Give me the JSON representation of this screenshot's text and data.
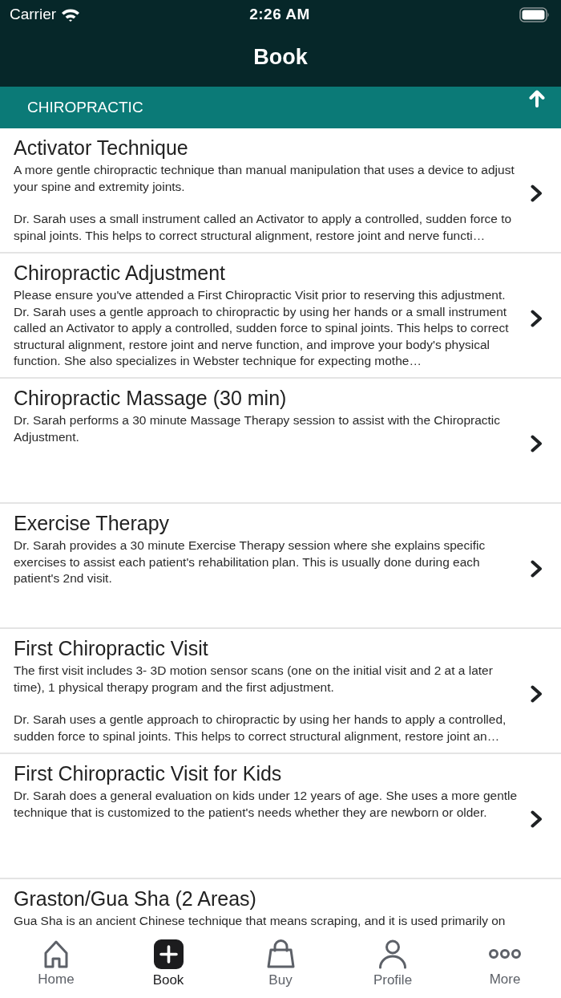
{
  "status_bar": {
    "carrier": "Carrier",
    "time": "2:26 AM"
  },
  "nav_bar": {
    "title": "Book"
  },
  "section": {
    "title": "CHIROPRACTIC"
  },
  "services": [
    {
      "title": "Activator Technique",
      "description": [
        "A more gentle chiropractic technique than manual manipulation that uses a device to adjust your spine and extremity joints.",
        "Dr. Sarah uses a small instrument called an Activator to apply a controlled, sudden force to spinal joints. This helps to correct structural alignment, restore joint and nerve functi…"
      ]
    },
    {
      "title": "Chiropractic Adjustment",
      "description": [
        "Please ensure you've attended a First Chiropractic Visit prior to reserving this adjustment. Dr. Sarah uses a gentle approach to chiropractic by using her hands or a small instrument called an Activator to apply a controlled, sudden force to spinal joints. This helps to correct structural alignment, restore joint and nerve function, and improve your body's physical function. She also specializes in Webster technique for expecting mothe…"
      ]
    },
    {
      "title": "Chiropractic Massage (30 min)",
      "description": [
        "Dr. Sarah performs a 30 minute Massage Therapy session to assist with the Chiropractic Adjustment."
      ]
    },
    {
      "title": "Exercise Therapy",
      "description": [
        "Dr. Sarah provides a 30 minute Exercise Therapy session where she explains specific exercises to assist each patient's rehabilitation plan. This is usually done during each patient's 2nd visit."
      ]
    },
    {
      "title": "First Chiropractic Visit",
      "description": [
        "The first visit includes 3- 3D motion sensor scans (one on the initial visit and 2 at a later time), 1 physical therapy program and the first adjustment.",
        "Dr. Sarah uses a gentle approach to chiropractic by using her hands to apply a controlled, sudden force to spinal joints. This helps to correct structural alignment, restore joint an…"
      ]
    },
    {
      "title": "First Chiropractic Visit for Kids",
      "description": [
        "Dr. Sarah does a general evaluation on kids under 12 years of age. She uses a more gentle technique that is customized to the patient's needs whether they are newborn or older."
      ]
    },
    {
      "title": "Graston/Gua Sha (2 Areas)",
      "description": [
        "Gua Sha is an ancient Chinese technique that means scraping, and it is used primarily on"
      ]
    }
  ],
  "tab_bar": [
    {
      "label": "Home",
      "selected": false
    },
    {
      "label": "Book",
      "selected": true
    },
    {
      "label": "Buy",
      "selected": false
    },
    {
      "label": "Profile",
      "selected": false
    },
    {
      "label": "More",
      "selected": false
    }
  ]
}
